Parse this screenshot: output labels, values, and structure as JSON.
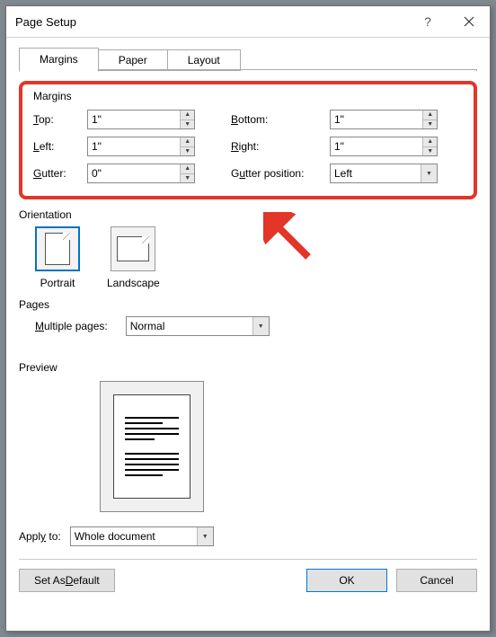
{
  "window": {
    "title": "Page Setup"
  },
  "tabs": {
    "margins": "Margins",
    "paper": "Paper",
    "layout": "Layout"
  },
  "margins": {
    "group_title": "Margins",
    "top": {
      "label_pre": "",
      "label_u": "T",
      "label_post": "op:",
      "value": "1\""
    },
    "bottom": {
      "label_pre": "",
      "label_u": "B",
      "label_post": "ottom:",
      "value": "1\""
    },
    "left": {
      "label_pre": "",
      "label_u": "L",
      "label_post": "eft:",
      "value": "1\""
    },
    "right": {
      "label_pre": "",
      "label_u": "R",
      "label_post": "ight:",
      "value": "1\""
    },
    "gutter": {
      "label_pre": "",
      "label_u": "G",
      "label_post": "utter:",
      "value": "0\""
    },
    "gutter_pos": {
      "label_pre1": "G",
      "label_u1": "u",
      "label_post1": "tter position:",
      "value": "Left"
    }
  },
  "orientation": {
    "title": "Orientation",
    "portrait": "Portrait",
    "landscape": "Landscape"
  },
  "pages": {
    "title": "Pages",
    "multiple_pre": "",
    "multiple_u": "M",
    "multiple_post": "ultiple pages:",
    "value": "Normal"
  },
  "preview": {
    "title": "Preview"
  },
  "apply": {
    "label_pre": "Appl",
    "label_u": "y",
    "label_post": " to:",
    "value": "Whole document"
  },
  "buttons": {
    "default_pre": "Set As ",
    "default_u": "D",
    "default_post": "efault",
    "ok": "OK",
    "cancel": "Cancel"
  }
}
